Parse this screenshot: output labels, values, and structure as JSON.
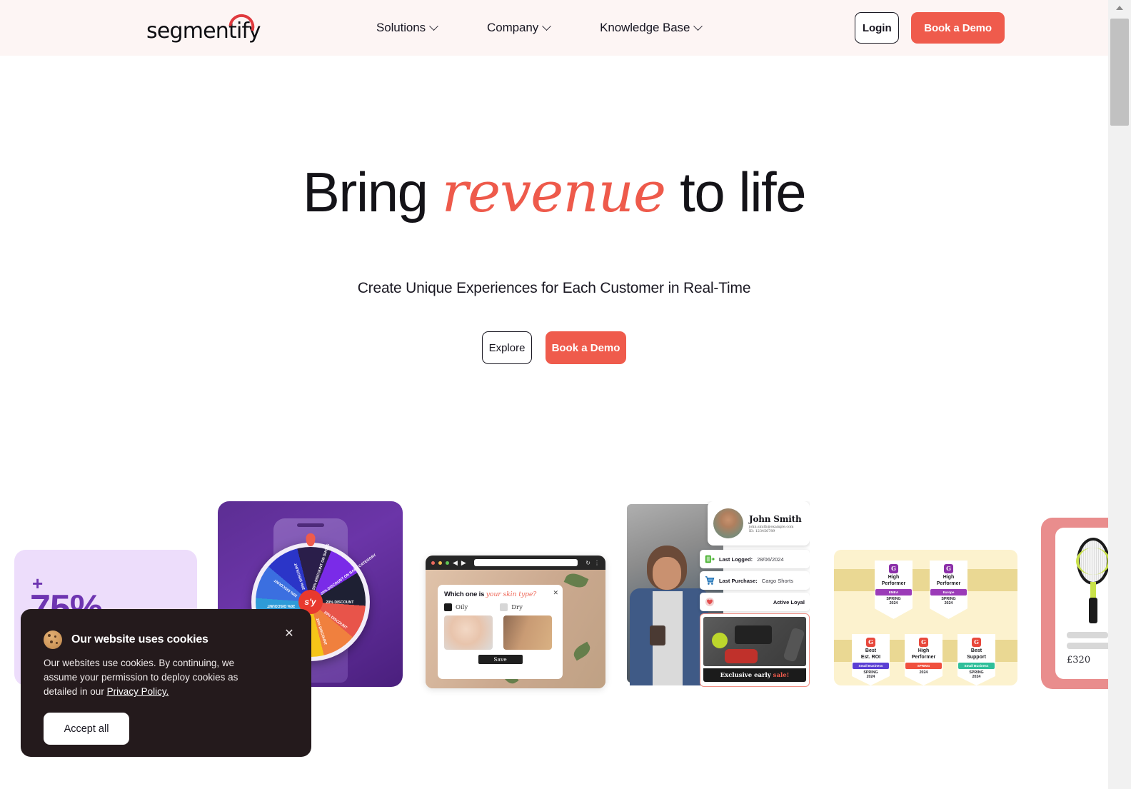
{
  "header": {
    "logo_text": "segmentify",
    "nav": [
      {
        "label": "Solutions",
        "icon": "chevron-down-icon"
      },
      {
        "label": "Company",
        "icon": "chevron-down-icon"
      },
      {
        "label": "Knowledge Base",
        "icon": "chevron-down-icon"
      }
    ],
    "login_label": "Login",
    "demo_label": "Book a Demo",
    "background": "#FDF5F4"
  },
  "hero": {
    "title_part1": "Bring ",
    "title_accent": "revenue",
    "title_part2": " to life",
    "subtitle": "Create Unique Experiences for Each Customer in Real-Time",
    "explore_label": "Explore",
    "demo_label": "Book a Demo",
    "accent_color": "#EE5A4B"
  },
  "cards": {
    "stat": {
      "plus": "+",
      "value": "75%",
      "color": "#6E35B1",
      "background": "#EDDDFB"
    },
    "wheel": {
      "hub_label": "s'y",
      "segments": [
        "20% DISCOUNT ON SHOES",
        "20% DISCOUNT ON BABY CATEGORY",
        "20% DISCOUNT",
        "20% DISCOUNT",
        "20% DISCOUNT",
        "20% DISCOUNT",
        "20% DISCOUNT",
        "20% DISCOUNT"
      ]
    },
    "quiz": {
      "question_plain": "Which one is ",
      "question_accent": "your skin type?",
      "option_a": "Oily",
      "option_b": "Dry",
      "save_label": "Save",
      "close_icon": "close-icon"
    },
    "profile": {
      "name": "John Smith",
      "email": "john.smith@example.com",
      "id": "ID: 123456789",
      "rows": [
        {
          "label": "Last Logged:",
          "value": "28/06/2024",
          "icon": "login-icon"
        },
        {
          "label": "Last Purchase:",
          "value": "Cargo Shorts",
          "icon": "cart-icon"
        },
        {
          "label": "Active Loyal",
          "value": "",
          "icon": "heart-icon"
        }
      ],
      "promo_plain": "Exclusive early ",
      "promo_accent": "sale!"
    },
    "badges": {
      "items": [
        {
          "title": "High\nPerformer",
          "ribbon": "EMEA",
          "ribbon_color": "#9B3BB8",
          "sub": "SPRING\n2024",
          "g_color": "#8B2FA8"
        },
        {
          "title": "High\nPerformer",
          "ribbon": "Europe",
          "ribbon_color": "#9B3BB8",
          "sub": "SPRING\n2024",
          "g_color": "#8B2FA8"
        },
        {
          "title": "Best\nEst. ROI",
          "ribbon": "Small Business",
          "ribbon_color": "#5B3FD4",
          "sub": "SPRING\n2024",
          "g_color": "#E8483C"
        },
        {
          "title": "High\nPerformer",
          "ribbon": "SPRING",
          "ribbon_color": "#F0503E",
          "sub": "2024",
          "g_color": "#E8483C"
        },
        {
          "title": "Best\nSupport",
          "ribbon": "Small Business",
          "ribbon_color": "#2FBF9A",
          "sub": "SPRING\n2024",
          "g_color": "#E8483C"
        }
      ],
      "g_letter": "G"
    },
    "product": {
      "price": "£320"
    }
  },
  "cookie": {
    "icon": "cookie-icon",
    "title": "Our website uses cookies",
    "body_part1": "Our websites use cookies. By continuing, we assume your permission to deploy cookies as detailed in our ",
    "link": "Privacy Policy.",
    "accept_label": "Accept all",
    "close_icon": "close-icon",
    "background": "#241A1C"
  },
  "scrollbar": {
    "icon": "scroll-up-arrow-icon"
  }
}
